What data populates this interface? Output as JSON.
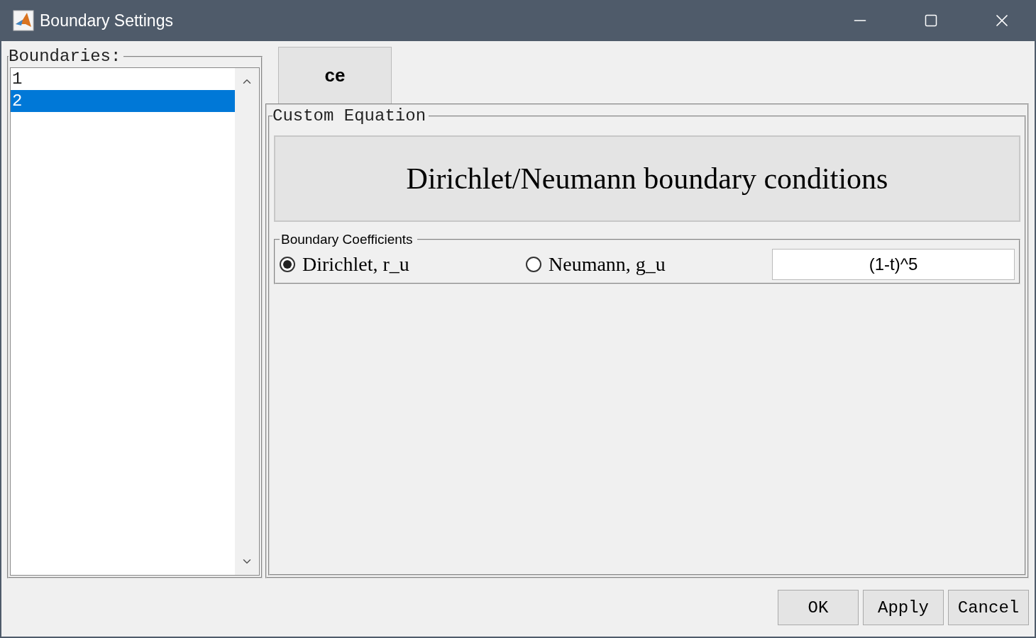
{
  "window": {
    "title": "Boundary Settings"
  },
  "boundaries": {
    "label": "Boundaries:",
    "items": [
      {
        "label": "1",
        "selected": false
      },
      {
        "label": "2",
        "selected": true
      }
    ]
  },
  "tabs": [
    {
      "label": "ce",
      "selected": true
    }
  ],
  "panel": {
    "title": "Custom Equation",
    "heading": "Dirichlet/Neumann boundary conditions",
    "coefficients": {
      "title": "Boundary Coefficients",
      "options": [
        {
          "label": "Dirichlet, r_u",
          "selected": true
        },
        {
          "label": "Neumann, g_u",
          "selected": false
        }
      ],
      "value": "(1-t)^5"
    }
  },
  "buttons": [
    "OK",
    "Apply",
    "Cancel"
  ]
}
